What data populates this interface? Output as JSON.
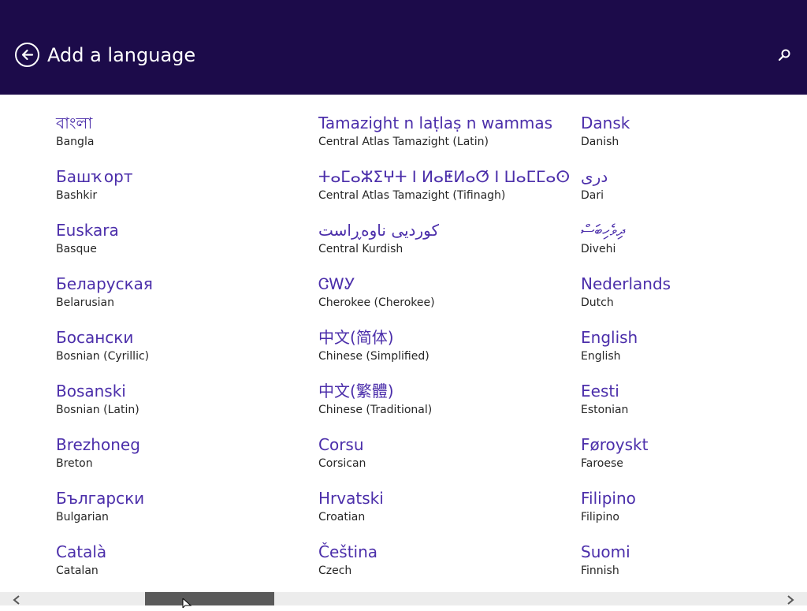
{
  "header": {
    "title": "Add a language",
    "back_icon": "back-arrow-icon",
    "search_icon": "search-icon"
  },
  "colors": {
    "header_background": "#1c0b4a",
    "native_name": "#4b2eaa",
    "english_name": "#262626"
  },
  "columns": [
    [
      {
        "native": "বাংলা",
        "english": "Bangla"
      },
      {
        "native": "Башҡорт",
        "english": "Bashkir"
      },
      {
        "native": "Euskara",
        "english": "Basque"
      },
      {
        "native": "Беларуская",
        "english": "Belarusian"
      },
      {
        "native": "Босански",
        "english": "Bosnian (Cyrillic)"
      },
      {
        "native": "Bosanski",
        "english": "Bosnian (Latin)"
      },
      {
        "native": "Brezhoneg",
        "english": "Breton"
      },
      {
        "native": "Български",
        "english": "Bulgarian"
      },
      {
        "native": "Català",
        "english": "Catalan"
      }
    ],
    [
      {
        "native": "Tamazight n laṭlaṣ n wammas",
        "english": "Central Atlas Tamazight (Latin)"
      },
      {
        "native": "ⵜⴰⵎⴰⵣⵉⵖⵜ ⵏ ⵍⴰⵟⵍⴰⵚ ⵏ ⵡⴰⵎⵎⴰⵙ",
        "english": "Central Atlas Tamazight (Tifinagh)"
      },
      {
        "native": "کوردیی ناوەڕاست",
        "english": "Central Kurdish"
      },
      {
        "native": "ᏣᎳᎩ",
        "english": "Cherokee (Cherokee)"
      },
      {
        "native": "中文(简体)",
        "english": "Chinese (Simplified)"
      },
      {
        "native": "中文(繁體)",
        "english": "Chinese (Traditional)"
      },
      {
        "native": "Corsu",
        "english": "Corsican"
      },
      {
        "native": "Hrvatski",
        "english": "Croatian"
      },
      {
        "native": "Čeština",
        "english": "Czech"
      }
    ],
    [
      {
        "native": "Dansk",
        "english": "Danish"
      },
      {
        "native": "درى",
        "english": "Dari"
      },
      {
        "native": "ދިވެހިބަސް",
        "english": "Divehi"
      },
      {
        "native": "Nederlands",
        "english": "Dutch"
      },
      {
        "native": "English",
        "english": "English"
      },
      {
        "native": "Eesti",
        "english": "Estonian"
      },
      {
        "native": "Føroyskt",
        "english": "Faroese"
      },
      {
        "native": "Filipino",
        "english": "Filipino"
      },
      {
        "native": "Suomi",
        "english": "Finnish"
      }
    ]
  ],
  "scrollbar": {
    "left_icon": "chevron-left-icon",
    "right_icon": "chevron-right-icon"
  }
}
